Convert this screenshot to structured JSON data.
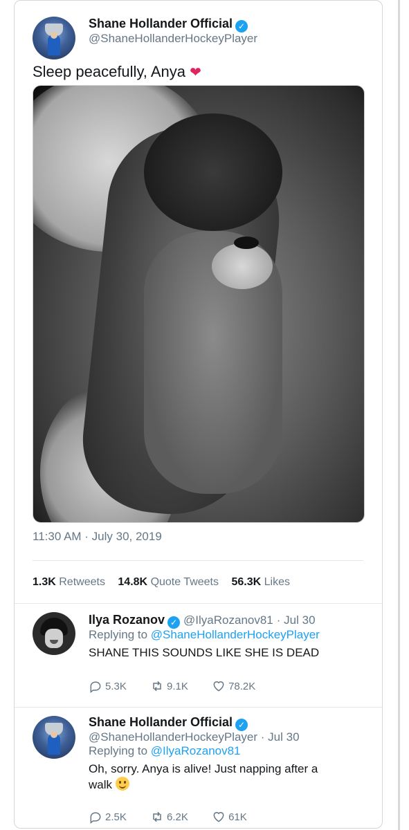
{
  "main_tweet": {
    "author_name": "Shane Hollander Official",
    "author_handle": "@ShaneHollanderHockeyPlayer",
    "text": "Sleep peacefully, Anya",
    "timestamp": "11:30 AM · July 30, 2019",
    "stats": {
      "retweets_count": "1.3K",
      "retweets_label": "Retweets",
      "quotes_count": "14.8K",
      "quotes_label": "Quote Tweets",
      "likes_count": "56.3K",
      "likes_label": "Likes"
    }
  },
  "replies": [
    {
      "author_name": "Ilya Rozanov",
      "author_handle": "@IlyaRozanov81",
      "date": "· Jul 30",
      "replying_to_label": "Replying to",
      "replying_to_handle": "@ShaneHollanderHockeyPlayer",
      "text": "SHANE THIS SOUNDS LIKE SHE IS DEAD",
      "replies_count": "5.3K",
      "retweets_count": "9.1K",
      "likes_count": "78.2K"
    },
    {
      "author_name": "Shane Hollander Official",
      "author_handle": "@ShaneHollanderHockeyPlayer",
      "date": "· Jul 30",
      "replying_to_label": "Replying to",
      "replying_to_handle": "@IlyaRozanov81",
      "text_line1": "Oh, sorry. Anya is alive! Just napping after a",
      "text_line2": "walk",
      "replies_count": "2.5K",
      "retweets_count": "6.2K",
      "likes_count": "61K"
    }
  ],
  "icons": {
    "verified": "verified-check-icon",
    "reply": "speech-bubble-icon",
    "retweet": "retweet-arrows-icon",
    "like": "heart-outline-icon",
    "heart_emoji": "red-heart-emoji",
    "smile_emoji": "slightly-smiling-face-emoji"
  },
  "colors": {
    "accent": "#1da1f2",
    "secondary_text": "#657786",
    "heart": "#e0245e"
  }
}
